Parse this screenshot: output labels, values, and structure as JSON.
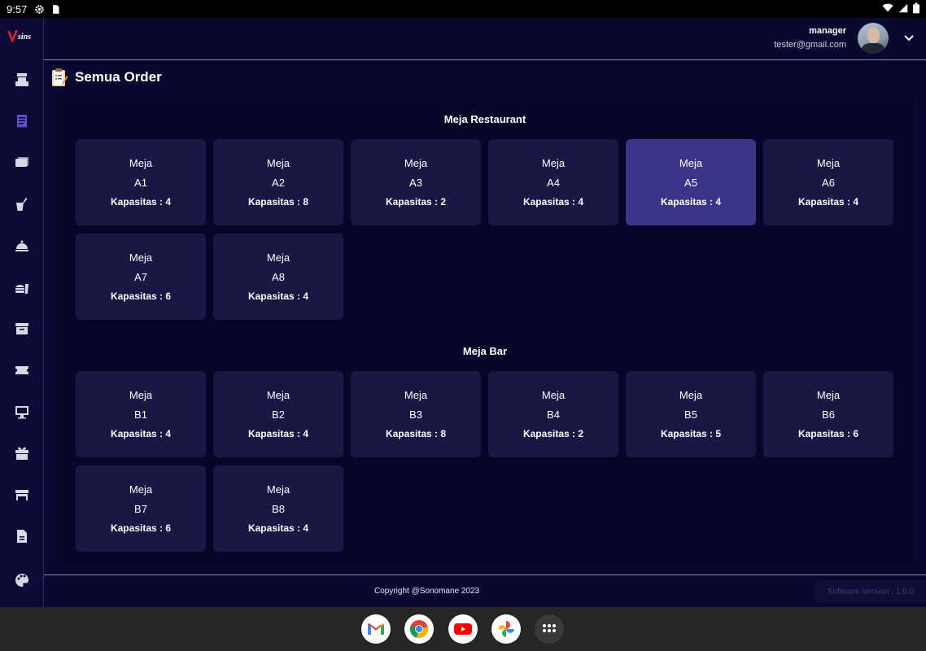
{
  "status_bar": {
    "time": "9:57"
  },
  "app": {
    "logo_text": "Vsins"
  },
  "user": {
    "role": "manager",
    "email": "tester@gmail.com"
  },
  "page": {
    "title": "Semua Order"
  },
  "sections": [
    {
      "title": "Meja Restaurant",
      "tables": [
        {
          "label": "Meja",
          "code": "A1",
          "capacity": "Kapasitas : 4",
          "selected": false
        },
        {
          "label": "Meja",
          "code": "A2",
          "capacity": "Kapasitas : 8",
          "selected": false
        },
        {
          "label": "Meja",
          "code": "A3",
          "capacity": "Kapasitas : 2",
          "selected": false
        },
        {
          "label": "Meja",
          "code": "A4",
          "capacity": "Kapasitas : 4",
          "selected": false
        },
        {
          "label": "Meja",
          "code": "A5",
          "capacity": "Kapasitas : 4",
          "selected": true
        },
        {
          "label": "Meja",
          "code": "A6",
          "capacity": "Kapasitas : 4",
          "selected": false
        },
        {
          "label": "Meja",
          "code": "A7",
          "capacity": "Kapasitas : 6",
          "selected": false
        },
        {
          "label": "Meja",
          "code": "A8",
          "capacity": "Kapasitas : 4",
          "selected": false
        }
      ]
    },
    {
      "title": "Meja Bar",
      "tables": [
        {
          "label": "Meja",
          "code": "B1",
          "capacity": "Kapasitas : 4",
          "selected": false
        },
        {
          "label": "Meja",
          "code": "B2",
          "capacity": "Kapasitas : 4",
          "selected": false
        },
        {
          "label": "Meja",
          "code": "B3",
          "capacity": "Kapasitas : 8",
          "selected": false
        },
        {
          "label": "Meja",
          "code": "B4",
          "capacity": "Kapasitas : 2",
          "selected": false
        },
        {
          "label": "Meja",
          "code": "B5",
          "capacity": "Kapasitas : 5",
          "selected": false
        },
        {
          "label": "Meja",
          "code": "B6",
          "capacity": "Kapasitas : 6",
          "selected": false
        },
        {
          "label": "Meja",
          "code": "B7",
          "capacity": "Kapasitas : 6",
          "selected": false
        },
        {
          "label": "Meja",
          "code": "B8",
          "capacity": "Kapasitas : 4",
          "selected": false
        }
      ]
    }
  ],
  "footer": {
    "copyright": "Copyright @Sonomane 2023",
    "version": "Software Version : 1.0.0"
  },
  "colors": {
    "background": "#0a0830",
    "card": "#1a1745",
    "card_selected": "#3b358a",
    "active_nav": "#5b52c9"
  },
  "sidebar_icons": [
    "cash-register-icon",
    "receipt-icon",
    "money-icon",
    "drink-icon",
    "cloche-icon",
    "food-icon",
    "archive-icon",
    "ticket-icon",
    "cashier-icon",
    "gift-icon",
    "store-icon",
    "document-icon",
    "palette-icon"
  ],
  "taskbar_apps": [
    "gmail-icon",
    "chrome-icon",
    "youtube-icon",
    "photos-icon",
    "app-drawer-icon"
  ]
}
